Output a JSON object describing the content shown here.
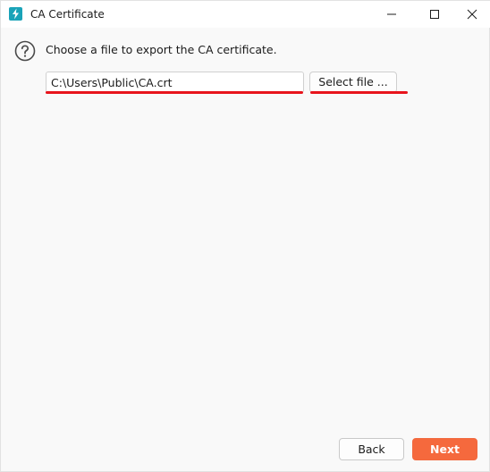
{
  "window": {
    "title": "CA Certificate",
    "accent_color": "#1aa3b8"
  },
  "icons": {
    "app": "lightning-icon",
    "minimize": "minimize-icon",
    "maximize": "maximize-icon",
    "close": "close-icon",
    "help": "question-circle-icon"
  },
  "main": {
    "instruction": "Choose a file to export the CA certificate.",
    "path_value": "C:\\Users\\Public\\CA.crt",
    "select_file_label": "Select file ..."
  },
  "footer": {
    "back_label": "Back",
    "next_label": "Next",
    "next_color": "#f5693d"
  },
  "annotation_color": "#e8141c"
}
